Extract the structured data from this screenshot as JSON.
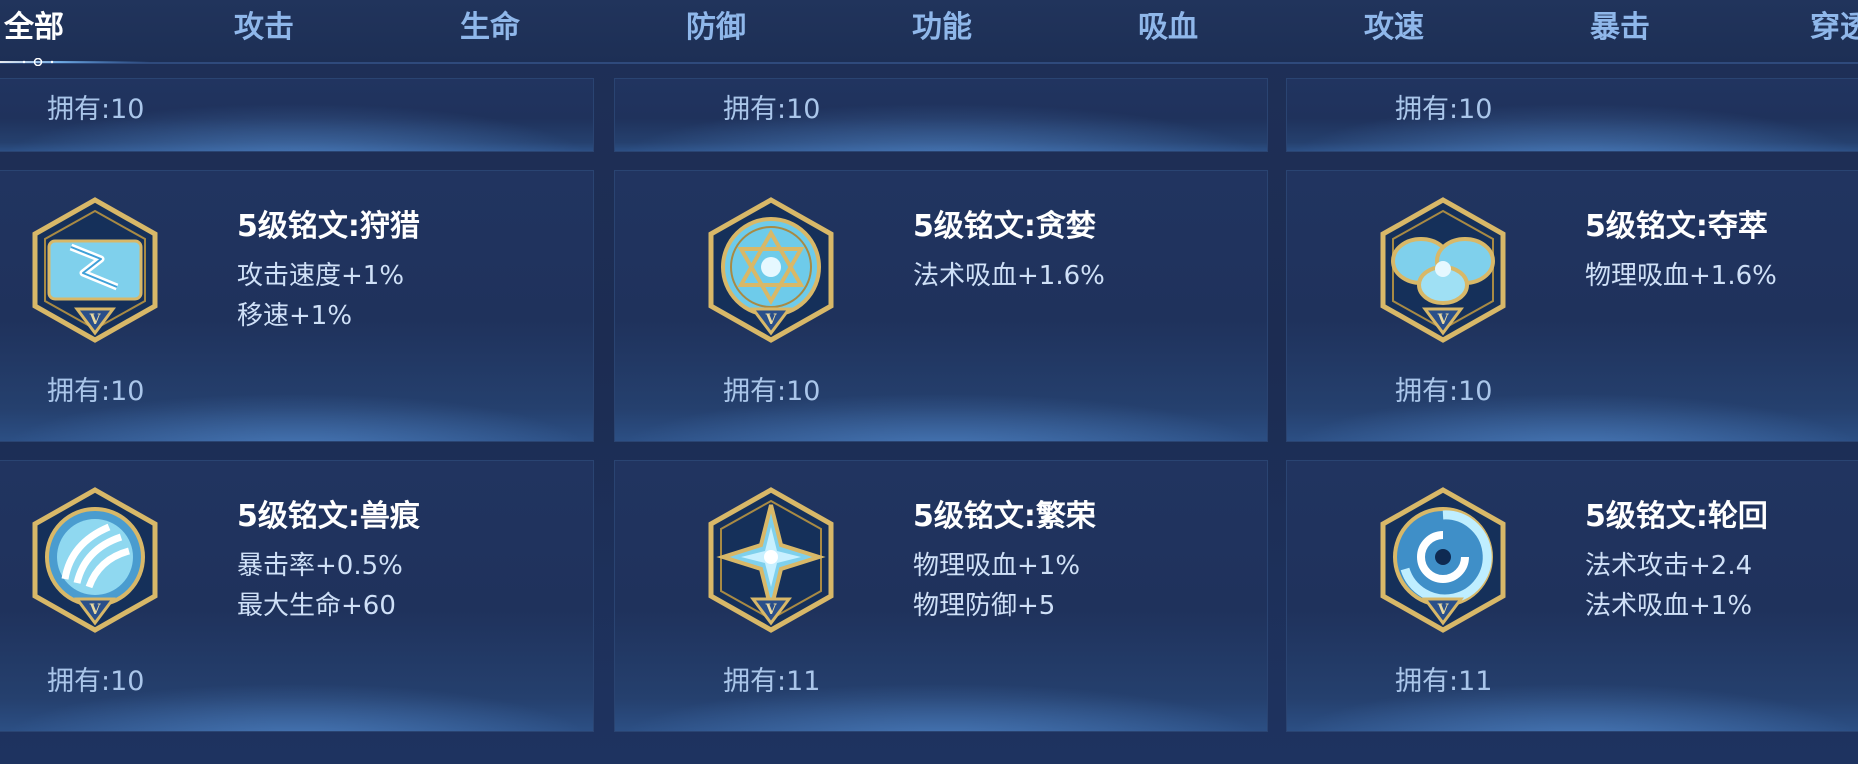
{
  "tabs": [
    {
      "label": "全部",
      "active": true
    },
    {
      "label": "攻击",
      "active": false
    },
    {
      "label": "生命",
      "active": false
    },
    {
      "label": "防御",
      "active": false
    },
    {
      "label": "功能",
      "active": false
    },
    {
      "label": "吸血",
      "active": false
    },
    {
      "label": "攻速",
      "active": false
    },
    {
      "label": "暴击",
      "active": false
    },
    {
      "label": "穿透",
      "active": false
    }
  ],
  "top_partial_row": [
    {
      "owned": "拥有:10"
    },
    {
      "owned": "拥有:10"
    },
    {
      "owned": "拥有:10"
    }
  ],
  "inscriptions": [
    {
      "title": "5级铭文:狩猎",
      "stats": [
        "攻击速度+1%",
        "移速+1%"
      ],
      "owned": "拥有:10",
      "icon": "lightning-rune-icon"
    },
    {
      "title": "5级铭文:贪婪",
      "stats": [
        "法术吸血+1.6%"
      ],
      "owned": "拥有:10",
      "icon": "hexagram-rune-icon"
    },
    {
      "title": "5级铭文:夺萃",
      "stats": [
        "物理吸血+1.6%"
      ],
      "owned": "拥有:10",
      "icon": "knot-rune-icon"
    },
    {
      "title": "5级铭文:兽痕",
      "stats": [
        "暴击率+0.5%",
        "最大生命+60"
      ],
      "owned": "拥有:10",
      "icon": "claw-rune-icon"
    },
    {
      "title": "5级铭文:繁荣",
      "stats": [
        "物理吸血+1%",
        "物理防御+5"
      ],
      "owned": "拥有:11",
      "icon": "star-rune-icon"
    },
    {
      "title": "5级铭文:轮回",
      "stats": [
        "法术攻击+2.4",
        "法术吸血+1%"
      ],
      "owned": "拥有:11",
      "icon": "swirl-rune-icon"
    }
  ],
  "rune_level_mark": "V",
  "colors": {
    "background": "#1c2c52",
    "card": "#213460",
    "title": "#ffffff",
    "tab_inactive": "#8fb7ea",
    "gold_frame": "#d8b868",
    "gem": "#8fd8f0"
  }
}
